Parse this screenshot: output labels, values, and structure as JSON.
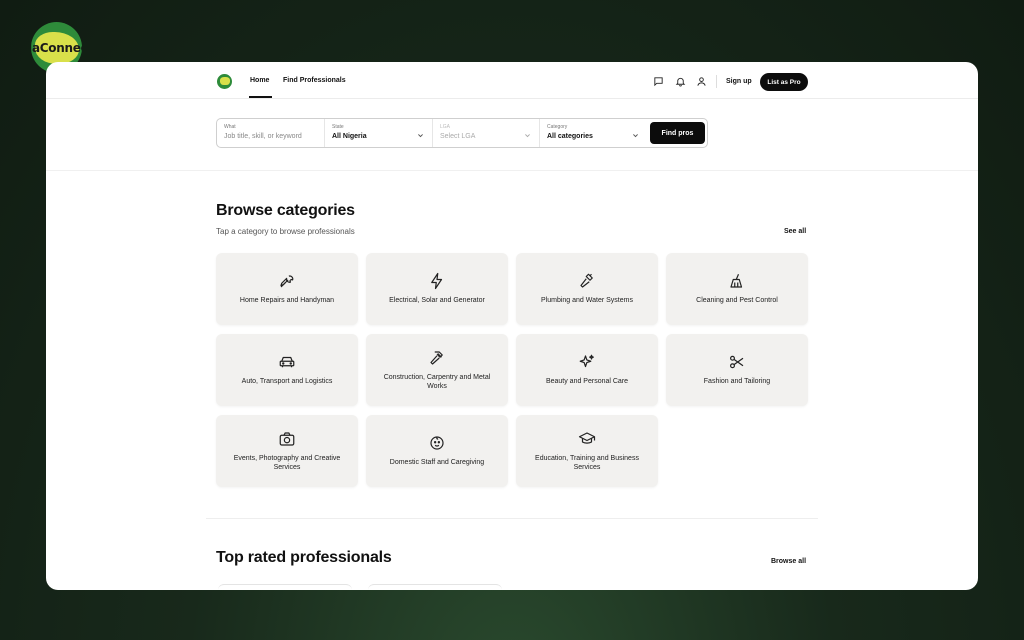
{
  "brand": {
    "logo_text": "NaConnect"
  },
  "nav": {
    "home": "Home",
    "find_professionals": "Find Professionals",
    "sign_up": "Sign up",
    "list_as_pro": "List as Pro",
    "icons": [
      "chat-icon",
      "bell-icon",
      "user-icon"
    ]
  },
  "search": {
    "what": {
      "label": "What",
      "placeholder": "Job title, skill, or keyword"
    },
    "state": {
      "label": "State",
      "value": "All Nigeria"
    },
    "lga": {
      "label": "LGA",
      "placeholder": "Select LGA"
    },
    "category": {
      "label": "Category",
      "value": "All categories"
    },
    "submit": "Find pros"
  },
  "categories_section": {
    "title": "Browse categories",
    "subtitle": "Tap a category to browse professionals",
    "see_all": "See all",
    "items": [
      {
        "label": "Home Repairs and Handyman",
        "icon": "wrench-icon"
      },
      {
        "label": "Electrical, Solar and Generator",
        "icon": "lightning-icon"
      },
      {
        "label": "Plumbing and Water Systems",
        "icon": "pipe-wrench-icon"
      },
      {
        "label": "Cleaning and Pest Control",
        "icon": "broom-icon"
      },
      {
        "label": "Auto, Transport and Logistics",
        "icon": "car-icon"
      },
      {
        "label": "Construction, Carpentry and Metal Works",
        "icon": "hammer-icon"
      },
      {
        "label": "Beauty and Personal Care",
        "icon": "sparkles-icon"
      },
      {
        "label": "Fashion and Tailoring",
        "icon": "scissors-icon"
      },
      {
        "label": "Events, Photography and Creative Services",
        "icon": "camera-icon"
      },
      {
        "label": "Domestic Staff and Caregiving",
        "icon": "baby-face-icon"
      },
      {
        "label": "Education, Training and Business Services",
        "icon": "graduation-cap-icon"
      }
    ]
  },
  "top_rated": {
    "title": "Top rated professionals",
    "browse_all": "Browse all"
  },
  "colors": {
    "background_dark": "#142417",
    "button_black": "#0c0c0c",
    "card_bg": "#f2f1ef",
    "logo_green": "#2e8b3a",
    "logo_yellow": "#d9e04a"
  }
}
